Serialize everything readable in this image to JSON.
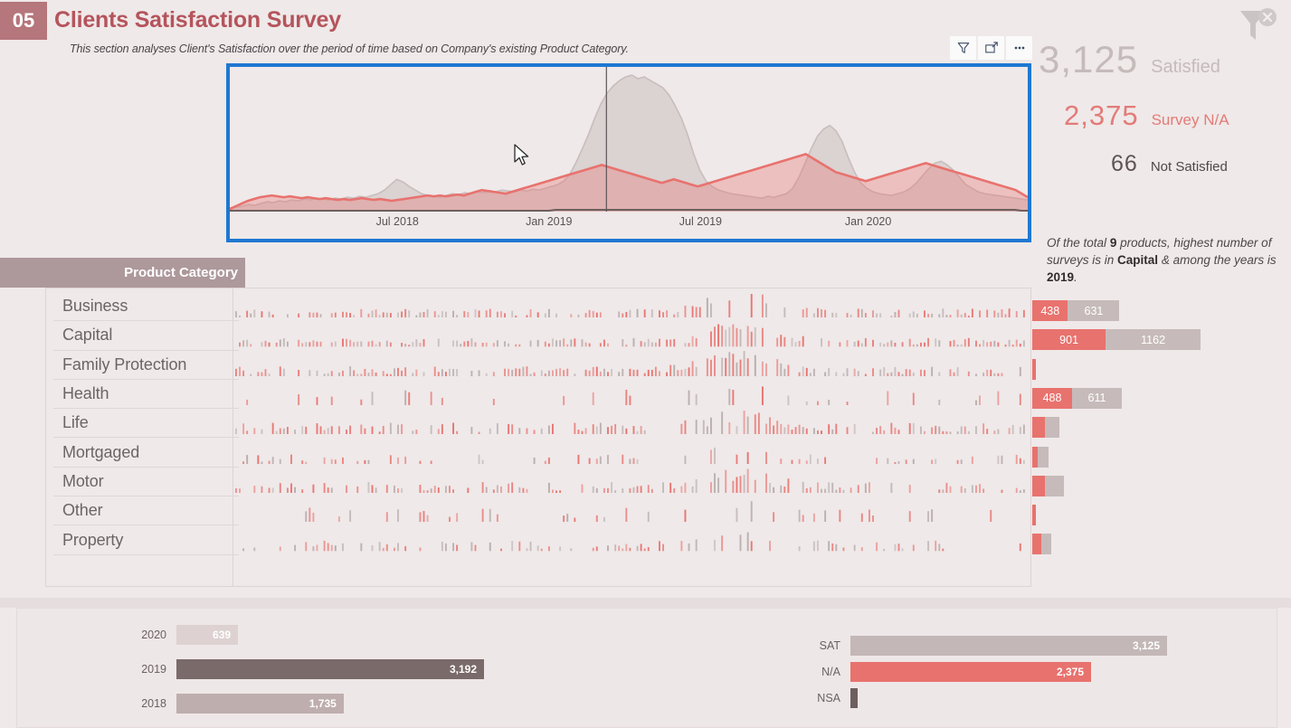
{
  "header": {
    "section_number": "05",
    "title": "Clients Satisfaction Survey",
    "subtitle": "This section analyses Client's Satisfaction over the period of time based on Company's existing Product Category.",
    "clear_filter_icon": "clear-filter-icon"
  },
  "visual_toolbar": {
    "filter_icon": "filter-icon",
    "focus_icon": "focus-mode-icon",
    "more_icon": "more-options-icon"
  },
  "kpis": [
    {
      "value": "3,125",
      "label": "Satisfied",
      "color": "#c5bbba"
    },
    {
      "value": "2,375",
      "label": "Survey N/A",
      "color": "#e37b77"
    },
    {
      "value": "66",
      "label": "Not Satisfied",
      "color": "#4f4749"
    }
  ],
  "annotation": {
    "part1": "Of the total",
    "count": "9",
    "part2": "products, highest number of surveys is in",
    "top_category": "Capital",
    "part3": "& among the years is",
    "top_year": "2019",
    "part4": "."
  },
  "timeline": {
    "selected": true,
    "axis_labels": [
      "Jul 2018",
      "Jan 2019",
      "Jul 2019",
      "Jan 2020"
    ],
    "axis_positions_pct": [
      21,
      40,
      59,
      80
    ],
    "cursor_visible": true
  },
  "product_category": {
    "header": "Product Category",
    "items": [
      "Business",
      "Capital",
      "Family Protection",
      "Health",
      "Life",
      "Mortgaged",
      "Motor",
      "Other",
      "Property"
    ]
  },
  "category_totals": [
    {
      "category": "Business",
      "na": 438,
      "sat": 631,
      "na_label": "438",
      "sat_label": "631",
      "show_labels": true
    },
    {
      "category": "Capital",
      "na": 901,
      "sat": 1162,
      "na_label": "901",
      "sat_label": "1162",
      "show_labels": true
    },
    {
      "category": "Family Protection",
      "na": 22,
      "sat": 0,
      "na_label": "",
      "sat_label": "",
      "show_labels": false
    },
    {
      "category": "Health",
      "na": 488,
      "sat": 611,
      "na_label": "488",
      "sat_label": "611",
      "show_labels": true
    },
    {
      "category": "Life",
      "na": 150,
      "sat": 180,
      "na_label": "",
      "sat_label": "",
      "show_labels": false
    },
    {
      "category": "Mortgaged",
      "na": 70,
      "sat": 135,
      "na_label": "",
      "sat_label": "",
      "show_labels": false
    },
    {
      "category": "Motor",
      "na": 160,
      "sat": 225,
      "na_label": "",
      "sat_label": "",
      "show_labels": false
    },
    {
      "category": "Other",
      "na": 25,
      "sat": 0,
      "na_label": "",
      "sat_label": "",
      "show_labels": false
    },
    {
      "category": "Property",
      "na": 110,
      "sat": 120,
      "na_label": "",
      "sat_label": "",
      "show_labels": false
    }
  ],
  "chart_data": [
    {
      "type": "area",
      "name": "satisfaction-timeline",
      "title": "",
      "xlabel": "",
      "ylabel": "",
      "x_tick_labels": [
        "Jul 2018",
        "Jan 2019",
        "Jul 2019",
        "Jan 2020"
      ],
      "grid": false,
      "legend": "none",
      "series": [
        {
          "name": "Satisfied",
          "color": "#c9bdbd",
          "values": [
            4,
            5,
            6,
            8,
            7,
            9,
            11,
            10,
            12,
            11,
            13,
            12,
            14,
            13,
            15,
            14,
            13,
            15,
            14,
            16,
            15,
            17,
            16,
            18,
            20,
            24,
            30,
            36,
            33,
            28,
            24,
            20,
            18,
            17,
            16,
            18,
            20,
            19,
            21,
            20,
            22,
            21,
            23,
            22,
            24,
            23,
            22,
            24,
            23,
            25,
            24,
            26,
            28,
            30,
            34,
            42,
            55,
            70,
            86,
            104,
            120,
            132,
            140,
            146,
            150,
            152,
            148,
            150,
            146,
            142,
            138,
            130,
            118,
            104,
            86,
            64,
            46,
            34,
            28,
            24,
            22,
            20,
            19,
            18,
            17,
            16,
            15,
            17,
            16,
            18,
            20,
            26,
            38,
            54,
            70,
            84,
            92,
            96,
            90,
            78,
            60,
            44,
            32,
            26,
            22,
            20,
            19,
            18,
            20,
            22,
            26,
            32,
            40,
            48,
            54,
            56,
            52,
            46,
            38,
            30,
            26,
            22,
            20,
            19,
            18,
            17,
            16,
            15,
            14,
            13
          ]
        },
        {
          "name": "Survey N/A",
          "color": "#e8726e",
          "values": [
            3,
            6,
            9,
            12,
            14,
            16,
            17,
            18,
            17,
            16,
            17,
            16,
            15,
            16,
            15,
            14,
            15,
            14,
            13,
            14,
            13,
            14,
            15,
            14,
            13,
            14,
            13,
            12,
            13,
            14,
            15,
            16,
            17,
            18,
            17,
            18,
            17,
            18,
            19,
            18,
            20,
            22,
            24,
            23,
            22,
            21,
            20,
            22,
            24,
            26,
            28,
            30,
            32,
            34,
            36,
            38,
            40,
            42,
            44,
            46,
            48,
            50,
            52,
            50,
            48,
            46,
            44,
            42,
            40,
            38,
            36,
            34,
            32,
            34,
            36,
            34,
            32,
            30,
            28,
            30,
            32,
            34,
            36,
            38,
            40,
            42,
            44,
            46,
            48,
            50,
            52,
            54,
            56,
            58,
            60,
            62,
            64,
            60,
            56,
            52,
            48,
            44,
            42,
            40,
            38,
            36,
            34,
            36,
            38,
            40,
            42,
            44,
            46,
            48,
            50,
            52,
            54,
            52,
            50,
            48,
            46,
            44,
            42,
            40,
            38,
            36,
            34,
            32,
            30,
            28,
            26,
            24,
            20,
            16
          ]
        },
        {
          "name": "Baseline",
          "color": "#6d5f5f",
          "values": [
            1,
            1,
            1,
            1,
            1,
            1,
            1,
            1,
            1,
            1,
            1,
            1,
            1,
            1,
            1,
            1,
            1,
            1,
            1,
            1,
            1,
            1,
            1,
            1,
            1,
            1,
            1,
            1,
            1,
            1,
            1,
            1,
            1,
            1,
            1,
            1,
            1,
            1,
            1,
            1,
            1,
            1,
            1,
            1,
            1,
            1,
            1,
            1,
            1,
            1,
            1,
            2,
            2,
            2,
            2,
            2,
            2,
            2,
            2,
            2,
            2,
            2,
            2,
            2,
            2,
            2,
            2,
            2,
            2,
            2,
            2,
            2,
            2,
            2,
            2,
            2,
            2,
            2,
            2,
            2,
            2,
            2,
            2,
            2,
            2,
            2,
            2,
            2,
            2,
            2,
            2,
            2,
            2,
            2,
            2,
            2,
            2,
            2,
            2,
            2,
            2,
            2,
            2,
            2,
            2,
            2,
            2,
            2,
            2,
            2,
            2,
            2,
            2,
            2,
            2,
            2,
            2,
            2,
            2,
            2,
            2,
            2,
            2,
            2,
            1,
            1
          ]
        }
      ]
    },
    {
      "type": "bar",
      "name": "surveys-by-year",
      "orientation": "horizontal",
      "categories": [
        "2020",
        "2019",
        "2018"
      ],
      "values": [
        639,
        3192,
        1735
      ],
      "value_labels": [
        "639",
        "3,192",
        "1,735"
      ],
      "colors": [
        "#ddd1d1",
        "#7a6a6a",
        "#bfaeae"
      ],
      "max": 3192,
      "title": "",
      "xlabel": "",
      "ylabel": ""
    },
    {
      "type": "bar",
      "name": "surveys-by-status",
      "orientation": "horizontal",
      "categories": [
        "SAT",
        "N/A",
        "NSA"
      ],
      "values": [
        3125,
        2375,
        66
      ],
      "value_labels": [
        "3,125",
        "2,375",
        ""
      ],
      "colors": [
        "#c3b7b7",
        "#e8726e",
        "#6d5f5f"
      ],
      "max": 3125,
      "title": "",
      "xlabel": "",
      "ylabel": ""
    }
  ],
  "colors": {
    "accent_red": "#e8726e",
    "accent_gray": "#c6bbba",
    "dark": "#7a6a6a",
    "title": "#b5545c",
    "badge": "#b5767c",
    "header_band": "#ad989b",
    "background": "#efe9e9",
    "selection_border": "#1f78d1"
  }
}
